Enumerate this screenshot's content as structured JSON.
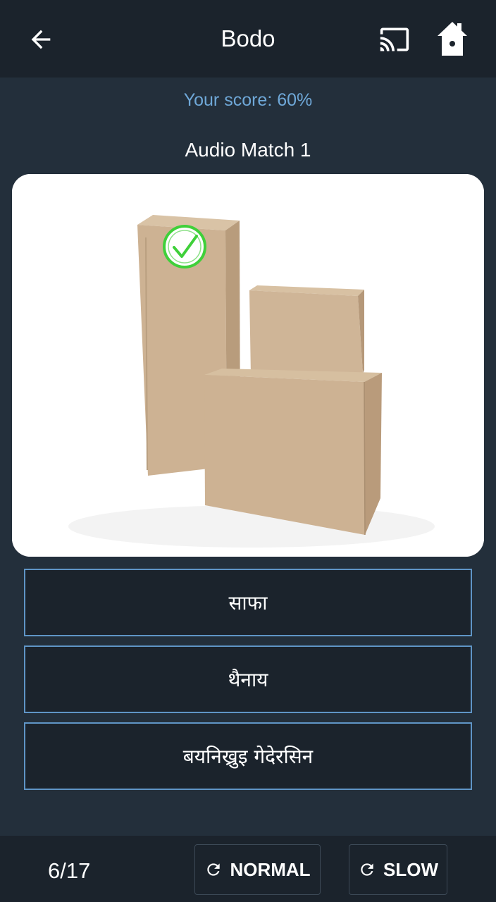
{
  "appbar": {
    "title": "Bodo",
    "icons": {
      "back": "arrow-left-icon",
      "cast": "cast-icon",
      "home": "home-icon"
    }
  },
  "score_text": "Your score: 60%",
  "quiz": {
    "title": "Audio Match 1",
    "image_badge": "check-circle-icon",
    "answers": [
      "साफा",
      "थैनाय",
      "बयनिख्रुइ गेदेरसिन"
    ]
  },
  "bottom": {
    "counter": "6/17",
    "normal_label": "NORMAL",
    "slow_label": "SLOW",
    "icons": {
      "replay": "refresh-icon"
    }
  },
  "colors": {
    "background": "#232f3b",
    "bar": "#1b232c",
    "accent_blue": "#6fa8d8",
    "answer_border": "#5f95c6",
    "check_green": "#3fd03a"
  }
}
